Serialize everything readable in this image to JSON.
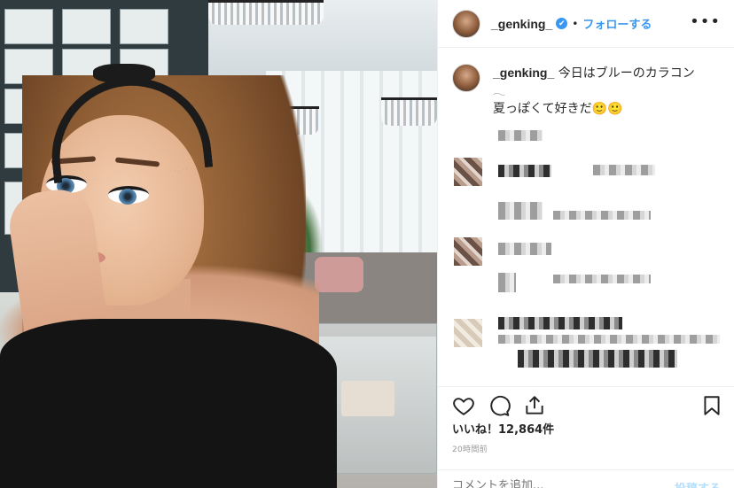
{
  "post": {
    "username": "_genking_",
    "verified_mark": "✔",
    "separator": "•",
    "follow_label": "フォローする",
    "more_label": "•••"
  },
  "caption": {
    "username": "_genking_",
    "line1": "今日はブルーのカラコン",
    "line1b": "𓂃",
    "line2": "夏っぽくて好きだ🙂🙂"
  },
  "engagement": {
    "likes_label": "いいね！12,864件",
    "time_ago": "20時間前"
  },
  "comment_box": {
    "placeholder": "コメントを追加...",
    "post_label": "投稿する"
  },
  "icons": {
    "like": "heart-icon",
    "comment": "comment-bubble-icon",
    "share": "share-icon",
    "save": "bookmark-icon",
    "verified": "verified-badge-icon",
    "more": "more-options-icon"
  },
  "colors": {
    "link_blue": "#3897f0",
    "post_disabled": "#b2dffc",
    "border": "#efefef",
    "text": "#262626"
  }
}
